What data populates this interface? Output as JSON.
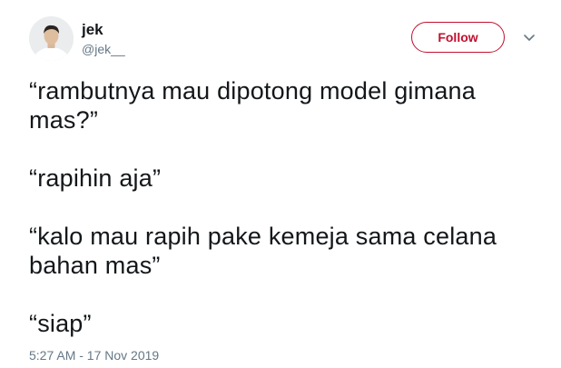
{
  "user": {
    "name": "jek",
    "handle": "@jek__"
  },
  "follow_button": {
    "label": "Follow",
    "color": "#c0102e"
  },
  "more_icon": "chevron-down-icon",
  "tweet": {
    "paragraphs": [
      {
        "lines": [
          "“rambutnya mau dipotong model gimana",
          "mas?”"
        ]
      },
      {
        "lines": [
          "“rapihin aja”"
        ]
      },
      {
        "lines": [
          "“kalo mau rapih pake kemeja sama celana",
          "bahan mas”"
        ]
      },
      {
        "lines": [
          "“siap”"
        ]
      }
    ],
    "timestamp": "5:27 AM - 17 Nov 2019"
  }
}
